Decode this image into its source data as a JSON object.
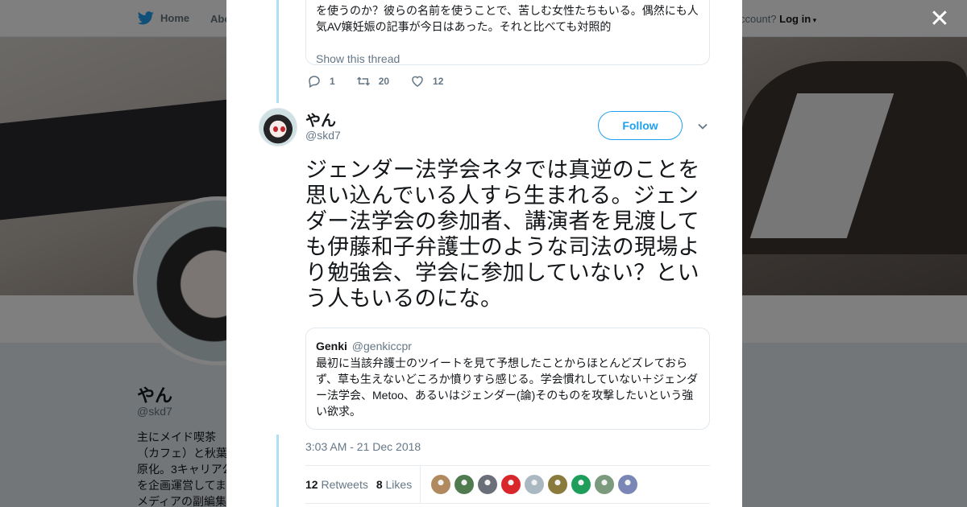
{
  "nav": {
    "home_label": "Home",
    "about_label": "Abo",
    "account_prompt": "ccount?",
    "login_label": "Log in"
  },
  "profile_bg": {
    "name": "やん",
    "handle": "@skd7",
    "bio": "主にメイド喫茶（カフェ）と秋葉原化。3キャリア公を企画運営してまメディアの副編集"
  },
  "previous_tweet": {
    "quoted_text": "を使うのか？彼らの名前を使うことで、苦しむ女性たちもいる。偶然にも人気AV嬢妊娠の記事が今日はあった。それと比べても対照的",
    "show_thread": "Show this thread",
    "replies": "1",
    "retweets": "20",
    "likes": "12"
  },
  "tweet": {
    "author_name": "やん",
    "author_handle": "@skd7",
    "follow_label": "Follow",
    "text": "ジェンダー法学会ネタでは真逆のことを思い込んでいる人すら生まれる。ジェンダー法学会の参加者、講演者を見渡しても伊藤和子弁護士のような司法の現場より勉強会、学会に参加していない？という人もいるのにな。",
    "quote": {
      "name": "Genki",
      "handle": "@genkiccpr",
      "text": "最初に当該弁護士のツイートを見て予想したことからほとんどズレておらず、草も生えないどころか憤りすら感じる。学会慣れしていない＋ジェンダー法学会、Metoo、あるいはジェンダー(論)そのものを攻撃したいという強い欲求。"
    },
    "timestamp": "3:03 AM - 21 Dec 2018",
    "retweet_count": "12",
    "retweets_label": "Retweets",
    "like_count": "8",
    "likes_label": "Likes"
  },
  "colors": {
    "accent": "#1da1f2",
    "thread_line": "#aee0f4",
    "muted": "#657786"
  },
  "liker_avatars": [
    {
      "color": "#b08a5e"
    },
    {
      "color": "#4f7b4f"
    },
    {
      "color": "#6b6f7a"
    },
    {
      "color": "#d9262b"
    },
    {
      "color": "#aab8c2"
    },
    {
      "color": "#8a7a3c"
    },
    {
      "color": "#1e9e5a"
    },
    {
      "color": "#7c9a7e"
    },
    {
      "color": "#7a86b5"
    }
  ],
  "icons": [
    "twitter-bird-icon",
    "reply-icon",
    "retweet-icon",
    "like-icon",
    "chevron-down-icon",
    "close-icon"
  ]
}
